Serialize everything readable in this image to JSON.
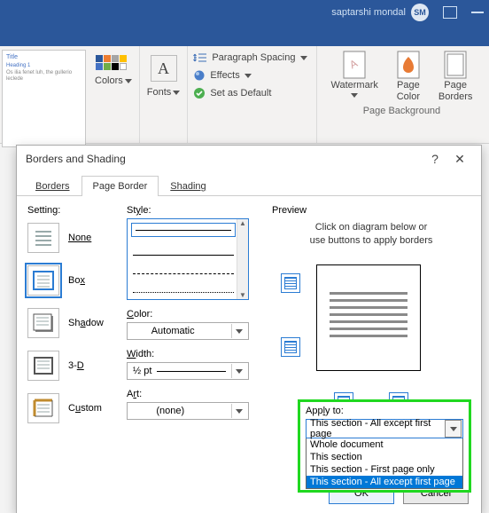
{
  "titlebar": {
    "username": "saptarshi mondal",
    "initials": "SM"
  },
  "ribbon": {
    "colors": "Colors",
    "fonts": "Fonts",
    "paragraph_spacing": "Paragraph Spacing",
    "effects": "Effects",
    "set_default": "Set as Default",
    "watermark": "Watermark",
    "page_color": "Page\nColor",
    "page_borders": "Page\nBorders",
    "page_bg_caption": "Page Background",
    "nav_thumb_title": "Title",
    "nav_thumb_sub": "Heading 1"
  },
  "dialog": {
    "title": "Borders and Shading",
    "tabs": {
      "borders": "Borders",
      "page_border": "Page Border",
      "shading": "Shading"
    },
    "setting_label": "Setting:",
    "settings": [
      "None",
      "Box",
      "Shadow",
      "3-D",
      "Custom"
    ],
    "style_label": "Style:",
    "color_label": "Color:",
    "color_value": "Automatic",
    "width_label": "Width:",
    "width_value": "½ pt",
    "art_label": "Art:",
    "art_value": "(none)",
    "preview_label": "Preview",
    "preview_hint1": "Click on diagram below or",
    "preview_hint2": "use buttons to apply borders",
    "apply_label": "Apply to:",
    "apply_value": "This section - All except first page",
    "apply_options": [
      "Whole document",
      "This section",
      "This section - First page only",
      "This section - All except first page"
    ],
    "ok": "OK",
    "cancel": "Cancel"
  }
}
